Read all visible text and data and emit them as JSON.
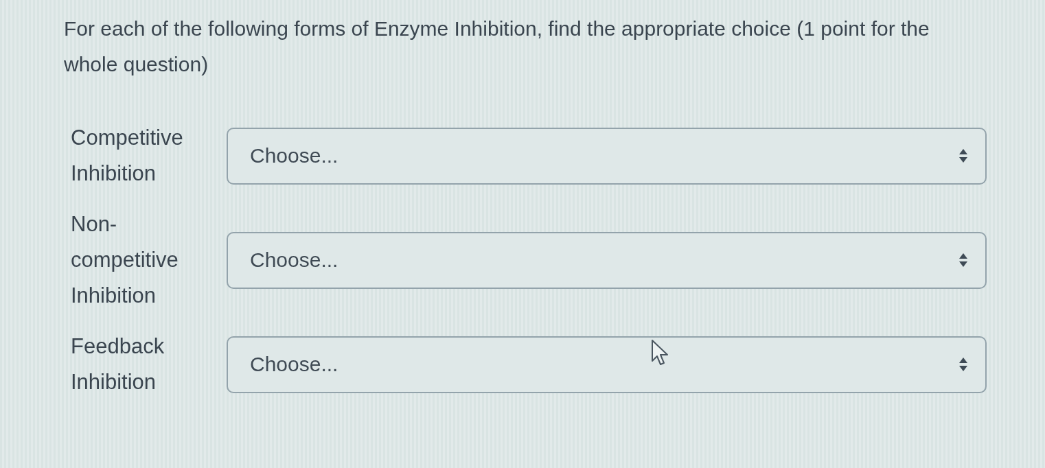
{
  "question": {
    "text": "For each of the following forms of Enzyme Inhibition, find the appropriate choice (1 point for the whole question)"
  },
  "items": [
    {
      "label": "Competitive Inhibition",
      "select": {
        "value": "Choose..."
      }
    },
    {
      "label": "Non-competitive Inhibition",
      "select": {
        "value": "Choose..."
      }
    },
    {
      "label": "Feedback Inhibition",
      "select": {
        "value": "Choose..."
      }
    }
  ]
}
